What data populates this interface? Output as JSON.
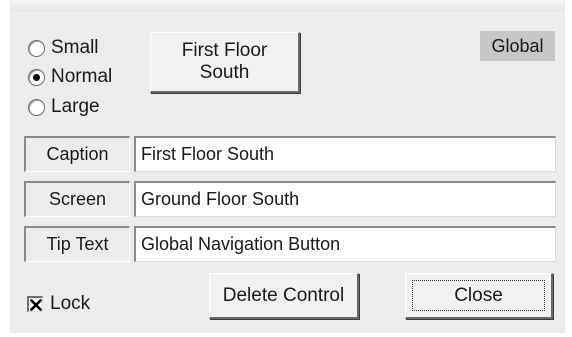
{
  "size_options": {
    "items": [
      {
        "label": "Small",
        "selected": false
      },
      {
        "label": "Normal",
        "selected": true
      },
      {
        "label": "Large",
        "selected": false
      }
    ]
  },
  "preview_button": {
    "label_line1": "First Floor",
    "label_line2": "South"
  },
  "badge": {
    "label": "Global"
  },
  "fields": {
    "caption": {
      "label": "Caption",
      "value": "First Floor South"
    },
    "screen": {
      "label": "Screen",
      "value": "Ground Floor South"
    },
    "tip_text": {
      "label": "Tip Text",
      "value": "Global Navigation Button"
    }
  },
  "lock": {
    "label": "Lock",
    "checked": true
  },
  "buttons": {
    "delete_label": "Delete Control",
    "close_label": "Close"
  }
}
